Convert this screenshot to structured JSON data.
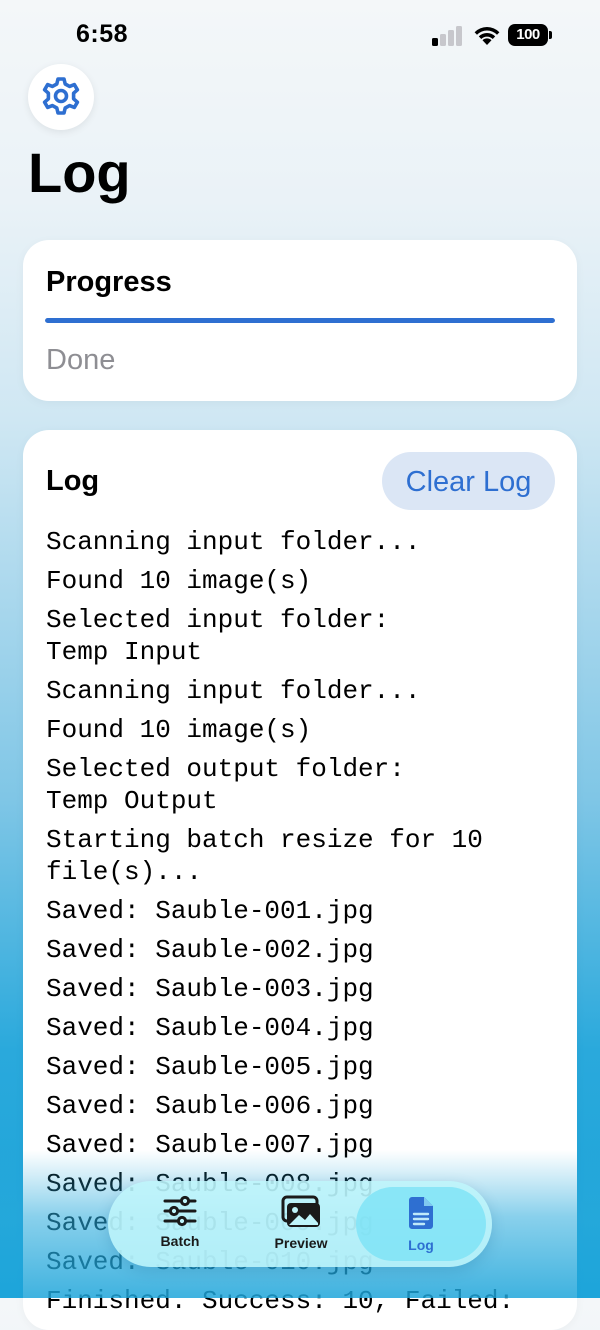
{
  "status": {
    "time": "6:58",
    "battery": "100"
  },
  "header": {
    "title": "Log"
  },
  "progress": {
    "title": "Progress",
    "fraction": 1.0,
    "status": "Done",
    "accent": "#2e6fd1"
  },
  "log": {
    "title": "Log",
    "clear_label": "Clear Log",
    "lines": [
      "Scanning input folder...",
      "Found 10 image(s)",
      "Selected input folder:\nTemp Input",
      "Scanning input folder...",
      "Found 10 image(s)",
      "Selected output folder:\nTemp Output",
      "Starting batch resize for 10\nfile(s)...",
      "Saved: Sauble-001.jpg",
      "Saved: Sauble-002.jpg",
      "Saved: Sauble-003.jpg",
      "Saved: Sauble-004.jpg",
      "Saved: Sauble-005.jpg",
      "Saved: Sauble-006.jpg",
      "Saved: Sauble-007.jpg",
      "Saved: Sauble-008.jpg",
      "Saved: Sauble-009.jpg",
      "Saved: Sauble-010.jpg",
      "Finished. Success: 10, Failed:"
    ]
  },
  "tabs": [
    {
      "label": "Batch",
      "icon": "sliders-icon",
      "selected": false
    },
    {
      "label": "Preview",
      "icon": "photos-icon",
      "selected": false
    },
    {
      "label": "Log",
      "icon": "document-icon",
      "selected": true
    }
  ]
}
